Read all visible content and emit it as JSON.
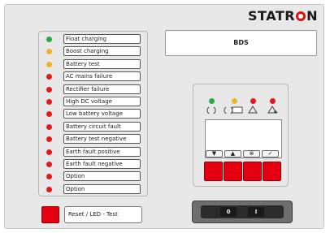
{
  "brand": {
    "logo_text": "STATRON"
  },
  "display": {
    "title": "BDS"
  },
  "alarms": [
    {
      "label": "Float charging",
      "led_color": "#2fa84a"
    },
    {
      "label": "Boost charging",
      "led_color": "#f0b428"
    },
    {
      "label": "Battery test",
      "led_color": "#f0b428"
    },
    {
      "label": "AC mains failure",
      "led_color": "#e01b1b"
    },
    {
      "label": "Rectifier failure",
      "led_color": "#e01b1b"
    },
    {
      "label": "High DC voltage",
      "led_color": "#e01b1b"
    },
    {
      "label": "Low battery voltage",
      "led_color": "#e01b1b"
    },
    {
      "label": "Battery circuit fault",
      "led_color": "#e01b1b"
    },
    {
      "label": "Battery test negative",
      "led_color": "#e01b1b"
    },
    {
      "label": "Earth fault positive",
      "led_color": "#e01b1b"
    },
    {
      "label": "Earth fault negative",
      "led_color": "#e01b1b"
    },
    {
      "label": "Option",
      "led_color": "#e01b1b"
    },
    {
      "label": "Option",
      "led_color": "#e01b1b"
    }
  ],
  "reset": {
    "label": "Reset / LED - Test"
  },
  "control_panel": {
    "status_leds": [
      "#2fa84a",
      "#f0b428",
      "#e01b1b",
      "#e01b1b"
    ],
    "status_icons": [
      "power-off-icon",
      "battery-icon",
      "warning-icon",
      "warning-filled-icon"
    ],
    "nav_buttons": [
      {
        "icon": "arrow-down-icon",
        "glyph": "▼"
      },
      {
        "icon": "arrow-up-icon",
        "glyph": "▲"
      },
      {
        "icon": "mute-icon",
        "glyph": "⊗"
      },
      {
        "icon": "check-icon",
        "glyph": "✓"
      }
    ]
  },
  "switch": {
    "positions": [
      "0",
      "I"
    ]
  },
  "colors": {
    "panel": "#e7e8e7",
    "accent_red": "#e40010"
  }
}
